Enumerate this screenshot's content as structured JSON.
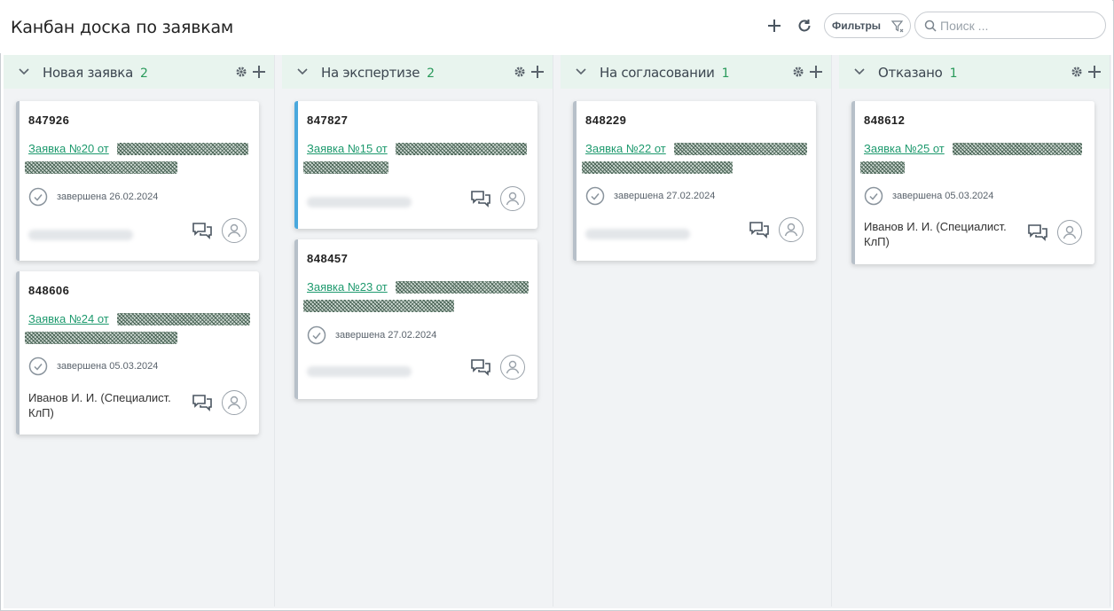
{
  "header": {
    "title": "Канбан доска по заявкам",
    "add_icon": "plus-icon",
    "refresh_icon": "refresh-icon",
    "filters_label": "Фильтры",
    "filter_icon": "filter-icon",
    "search_placeholder": "Поиск ..."
  },
  "colors": {
    "column_header_bg": "#e8f4ee",
    "count_green": "#2a9a5b",
    "link_green": "#1e9a6e",
    "card_accent_gray": "#b7c0c9",
    "card_accent_blue": "#4aa8dd"
  },
  "columns": [
    {
      "title": "Новая заявка",
      "count": "2",
      "cards": [
        {
          "id": "847926",
          "link": "Заявка №20 от",
          "status": "завершена 26.02.2024",
          "assignee": ""
        },
        {
          "id": "848606",
          "link": "Заявка №24 от",
          "status": "завершена 05.03.2024",
          "assignee": "Иванов И. И. (Специалист. КлП)"
        }
      ]
    },
    {
      "title": "На экспертизе",
      "count": "2",
      "cards": [
        {
          "id": "847827",
          "link": "Заявка №15 от",
          "status": "",
          "assignee": ""
        },
        {
          "id": "848457",
          "link": "Заявка №23 от",
          "status": "завершена 27.02.2024",
          "assignee": ""
        }
      ]
    },
    {
      "title": "На согласовании",
      "count": "1",
      "cards": [
        {
          "id": "848229",
          "link": "Заявка №22 от",
          "status": "завершена 27.02.2024",
          "assignee": ""
        }
      ]
    },
    {
      "title": "Отказано",
      "count": "1",
      "cards": [
        {
          "id": "848612",
          "link": "Заявка №25 от",
          "status": "завершена 05.03.2024",
          "assignee": "Иванов И. И. (Специалист. КлП)"
        }
      ]
    }
  ]
}
